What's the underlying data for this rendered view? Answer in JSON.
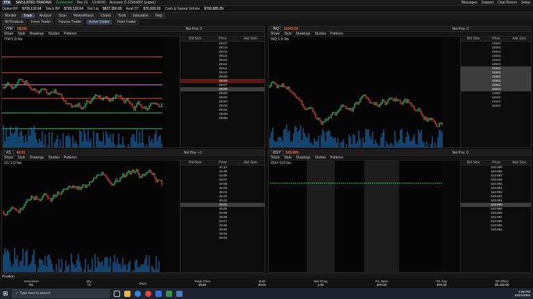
{
  "topbar": {
    "logo": "TTX",
    "account_label": "SIMULATED TRADING",
    "connected": "Connected",
    "user": "User: Paper Trading",
    "date": "Dec 21",
    "time": "13:00:00",
    "account": "Account: D-12964807 (paper)",
    "links": [
      "Messages",
      "Support",
      "Chat Rooms",
      "Setup"
    ]
  },
  "acct": {
    "option_bp": "Option BP",
    "option_bp_val": "$709,132.64",
    "stock_bp": "Stock BP",
    "stock_bp_val": "$709,132.64",
    "net_liq": "Net Liq",
    "net_liq_val": "$827,350.89",
    "avail": "Avail DT",
    "avail_val": "$70,000.00",
    "cash_sweep": "Cash & Sweep Vehicle",
    "cash_val": "$700,885.89"
  },
  "tabs": [
    "Monitor",
    "Trade",
    "Analyze",
    "Scan",
    "MarketWatch",
    "Charts",
    "Tools",
    "Education",
    "Help"
  ],
  "active_tab": "Trade",
  "subtabs": [
    "All Products",
    "Forex Trader",
    "Futures Trader",
    "Active Trader",
    "Paint Trader"
  ],
  "quads": [
    {
      "sym": "/YM",
      "price": "28106",
      "title": "/YM 5 D 5m",
      "pos": "Net Pos: 0",
      "ladder_prices": [
        "28117",
        "28116",
        "28115",
        "28114",
        "28113",
        "28112",
        "28111",
        "28110",
        "28109",
        "28108",
        "28107",
        "28106",
        "28105",
        "28104",
        "28103",
        "28102",
        "28101",
        "28100",
        "28099"
      ],
      "sel": "28106",
      "scale": [
        "28800",
        "28400",
        "28200",
        "28000",
        "27800"
      ]
    },
    {
      "sym": "/NQ",
      "price": "11643.00",
      "title": "/NQ 5 D 5m",
      "pos": "Net Pos: 0",
      "ladder_prices": [
        "11644.",
        "11644.",
        "11644.",
        "11644.",
        "11644.",
        "11644.",
        "11643.",
        "11643.",
        "11643.",
        "11643.",
        "11643.",
        "11643.",
        "11642.",
        "11642.",
        "11642.",
        "11642."
      ],
      "sel": "11643.",
      "scale": [
        "11750",
        "11700",
        "11650",
        "11600",
        "11550",
        "11500"
      ],
      "lbl": "Lo: 11560"
    },
    {
      "sym": "/CL",
      "price": "40.01",
      "title": "/CL 5 D 5m",
      "pos": "Net Pos: +1",
      "ladder_prices": [
        "40.10",
        "40.09",
        "40.08",
        "40.07",
        "40.06",
        "40.05",
        "40.04",
        "40.03",
        "40.02",
        "40.01",
        "40.00",
        "39.99",
        "39.98",
        "39.97",
        "39.96",
        "39.95",
        "39.94",
        "39.93"
      ],
      "sel": "40.01",
      "scale": [
        "41.0",
        "40.5",
        "40.0",
        "39.5",
        "39.0"
      ],
      "lbl": "Hi: 41.0"
    },
    {
      "sym": "/DXY",
      "price": "543.999",
      "title": "/DXY 5 D 5m",
      "pos": "Net Pos: 0",
      "ladder_prices": [
        "543.999",
        "543.998",
        "543.997",
        "543.996",
        "543.995",
        "543.994",
        "543.993",
        "543.992",
        "543.991",
        "543.990",
        "543.989",
        "543.988",
        "543.987",
        "543.986",
        "543.985",
        "543.984"
      ],
      "sel": "543.990",
      "scale": [
        "544",
        "543"
      ],
      "lbl": "Lo: 543.999"
    }
  ],
  "toolbar": {
    "share": "Share",
    "style": "Style",
    "drawings": "Drawings",
    "studies": "Studies",
    "patterns": "Patterns",
    "drawing_set": "Drawing set: Default"
  },
  "status": {
    "label": "Position"
  },
  "positions": {
    "headers": [
      "Instrument",
      "Qty",
      "Days",
      "Trade Price",
      "Mark",
      "Mrk Chng",
      "P/L Open",
      "P/L Day",
      "BP Effect"
    ],
    "values": [
      "/CL",
      "+1",
      "",
      "39.86",
      "40.01",
      "1.00",
      "$70.00",
      "$70.00",
      "$3,410.00"
    ]
  },
  "taskbar": {
    "search": "Type here to search",
    "time": "1:00 PM",
    "date": "10/21/2020"
  },
  "colors": {
    "accent": "#ff6a3d",
    "up": "#2ecc71",
    "down": "#e74c3c",
    "volume": "#1f6fb5"
  }
}
